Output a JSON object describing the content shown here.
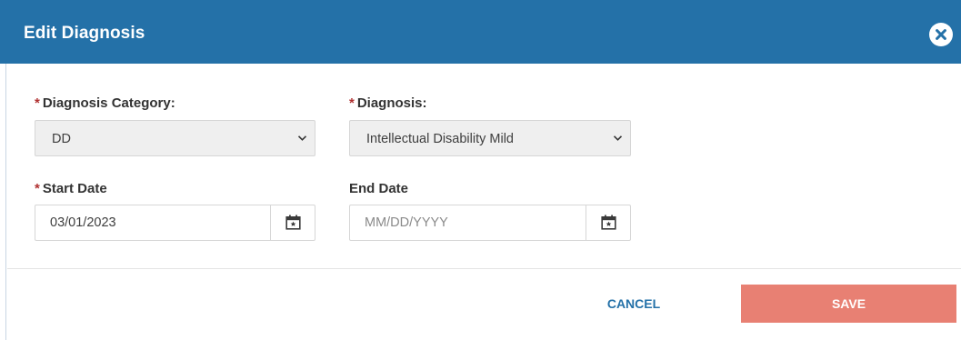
{
  "dialog": {
    "title": "Edit Diagnosis",
    "close_icon": "close-circle-icon"
  },
  "form": {
    "required_marker": "*",
    "diagnosis_category": {
      "label": "Diagnosis Category:",
      "required": true,
      "value": "DD"
    },
    "diagnosis": {
      "label": "Diagnosis:",
      "required": true,
      "value": "Intellectual Disability Mild"
    },
    "start_date": {
      "label": "Start Date",
      "required": true,
      "value": "03/01/2023",
      "placeholder": "MM/DD/YYYY"
    },
    "end_date": {
      "label": "End Date",
      "required": false,
      "value": "",
      "placeholder": "MM/DD/YYYY"
    }
  },
  "actions": {
    "cancel_label": "CANCEL",
    "save_label": "SAVE"
  },
  "colors": {
    "header": "#2471a8",
    "save_button": "#e88073",
    "required_marker": "#b03030",
    "cancel_text": "#2471a8"
  }
}
